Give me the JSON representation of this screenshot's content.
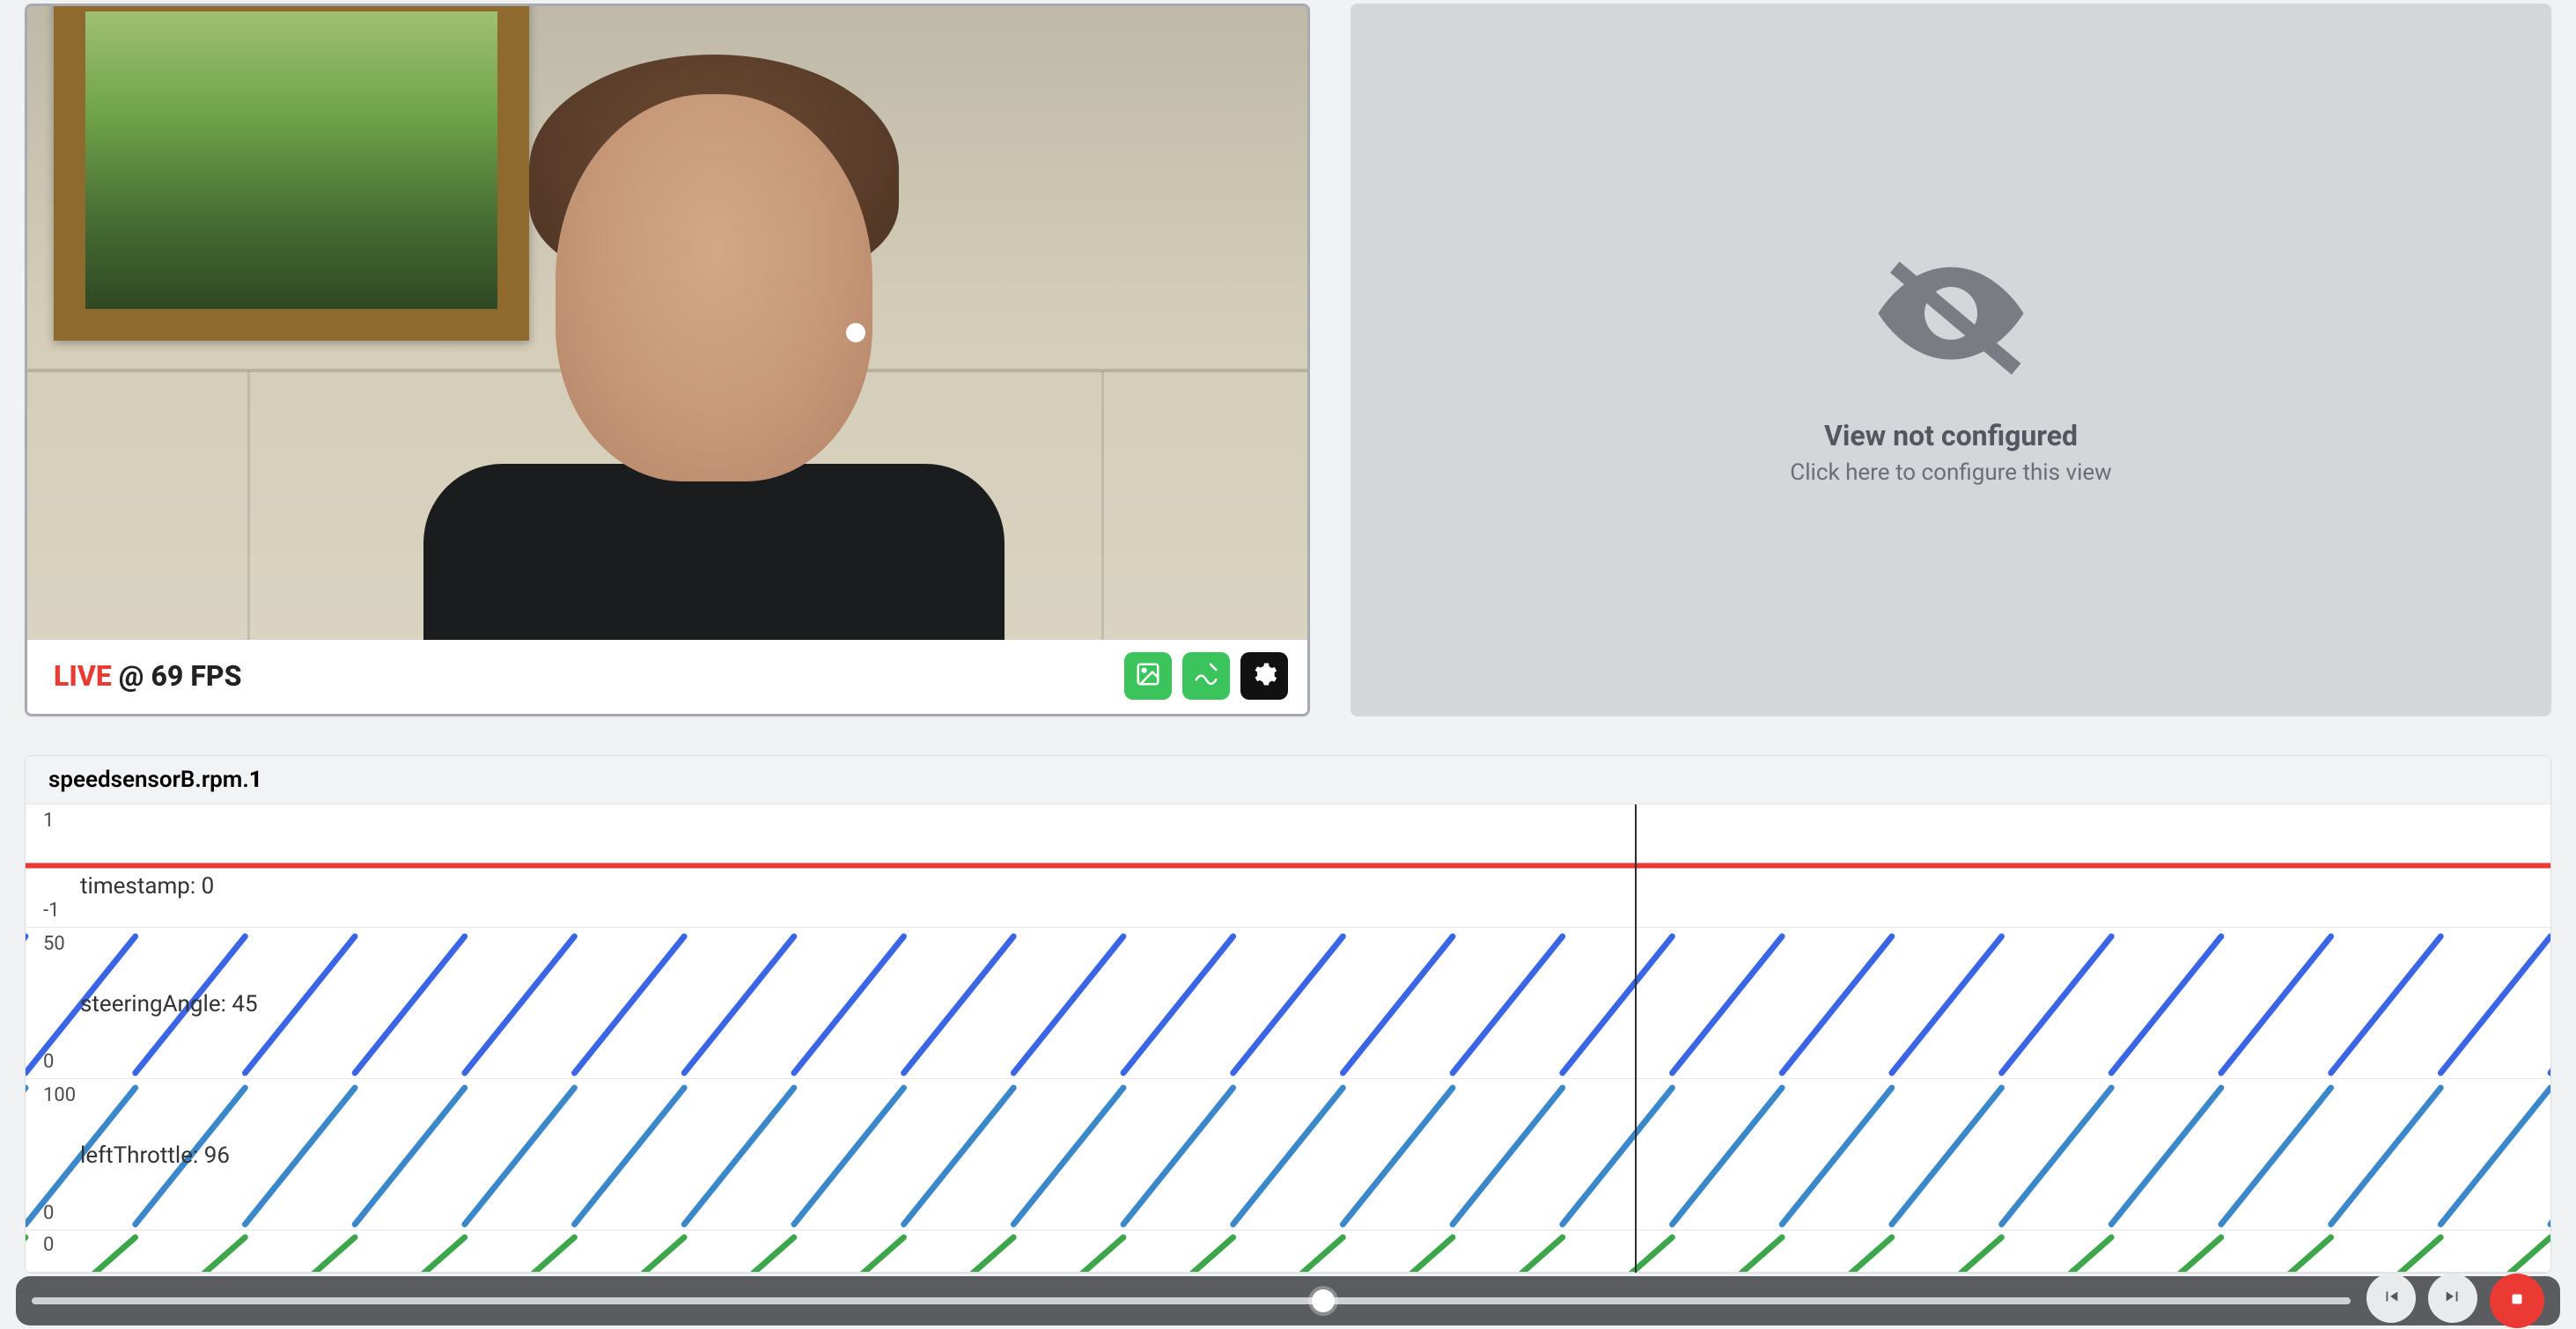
{
  "camera": {
    "live_label": "LIVE",
    "fps_label": "@ 69 FPS"
  },
  "empty_view": {
    "title": "View not configured",
    "subtitle": "Click here to configure this view"
  },
  "chart": {
    "title_prefix": "speedsensorB.rpm.",
    "title_suffix": "1",
    "lanes": [
      {
        "id": "timestamp",
        "label": "timestamp: 0",
        "ytop": "1",
        "ybot": "-1",
        "value": 0,
        "range": [
          -1,
          1
        ],
        "color": "#ea3a33",
        "type": "flat"
      },
      {
        "id": "steeringAngle",
        "label": "steeringAngle: 45",
        "ytop": "50",
        "ybot": "0",
        "value": 45,
        "range": [
          0,
          50
        ],
        "color": "#3a66e6",
        "type": "saw"
      },
      {
        "id": "leftThrottle",
        "label": "leftThrottle: 96",
        "ytop": "100",
        "ybot": "0",
        "value": 96,
        "range": [
          0,
          100
        ],
        "color": "#3a87c9",
        "type": "saw"
      },
      {
        "id": "extra",
        "label": "",
        "ytop": "0",
        "ybot": "",
        "value": null,
        "range": [
          0,
          50
        ],
        "color": "#3da64a",
        "type": "saw"
      }
    ],
    "cursor_fraction": 0.613
  },
  "chart_data": {
    "type": "line",
    "title": "speedsensorB.rpm.1",
    "x": "time (arbitrary, continuous, sawtooth period ≈ 1/23 of viewport)",
    "series": [
      {
        "name": "timestamp",
        "ylim": [
          -1,
          1
        ],
        "pattern": "constant",
        "value_at_cursor": 0,
        "color": "#ea3a33"
      },
      {
        "name": "steeringAngle",
        "ylim": [
          0,
          50
        ],
        "pattern": "sawtooth 0→50 repeating, 23 periods visible",
        "value_at_cursor": 45,
        "color": "#3a66e6"
      },
      {
        "name": "leftThrottle",
        "ylim": [
          0,
          100
        ],
        "pattern": "sawtooth 0→100 repeating, 23 periods visible",
        "value_at_cursor": 96,
        "color": "#3a87c9"
      },
      {
        "name": "(unnamed series 4)",
        "ylim": [
          0,
          50
        ],
        "pattern": "sawtooth 0→50 repeating, 23 periods visible (top cropped)",
        "value_at_cursor": null,
        "color": "#3da64a"
      }
    ]
  },
  "playback": {
    "position_fraction": 0.557
  }
}
